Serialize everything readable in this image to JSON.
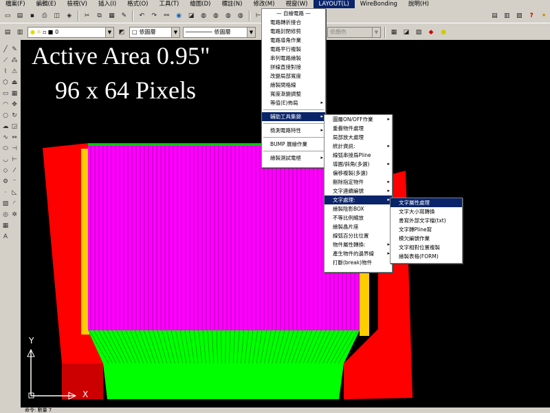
{
  "menubar": {
    "items": [
      "檔案(F)",
      "編輯(E)",
      "檢視(V)",
      "插入(I)",
      "格式(O)",
      "工具(T)",
      "繪圖(D)",
      "標註(N)",
      "修改(M)",
      "視窗(W)",
      "LAYOUT(L)",
      "WireBonding",
      "說明(H)"
    ],
    "active_index": 10
  },
  "toolbar2": {
    "layer_value": "0",
    "linetype_value": "依圖層",
    "lineweight_value": "依圖層",
    "color_value": "依顏色"
  },
  "drawing": {
    "title_line1": "Active Area 0.95\"",
    "title_line2": "96 x 64 Pixels",
    "axis_y": "Y",
    "axis_x": "X",
    "colors": {
      "panel": "#ff00ff",
      "fanout_bottom": "#00ff00",
      "traces": "#ff0000",
      "pads": "#ffcc00",
      "background": "#000000"
    }
  },
  "layout_menu": {
    "header": "— 自繪電路 —",
    "items": [
      {
        "label": "電路轉折接合",
        "sub": false
      },
      {
        "label": "電路封閉修剪",
        "sub": false
      },
      {
        "label": "電路導角作業",
        "sub": false
      },
      {
        "label": "電路平行複製",
        "sub": false
      },
      {
        "label": "串列電路繪製",
        "sub": false
      },
      {
        "label": "拼線直接對接",
        "sub": false
      },
      {
        "label": "改變局部寬度",
        "sub": false
      },
      {
        "label": "繪製間格線",
        "sub": false
      },
      {
        "label": "寬度漸變調整",
        "sub": false
      },
      {
        "label": "等值(E)佈局",
        "sub": true
      }
    ],
    "group2": [
      {
        "label": "輔助工具集錦",
        "sub": true,
        "highlighted": true
      },
      {
        "label": "檢測電路特性",
        "sub": true
      },
      {
        "label": "BUMP 展繪作業",
        "sub": false
      },
      {
        "label": "繪製測試電極",
        "sub": true
      }
    ]
  },
  "aux_menu": {
    "items": [
      {
        "label": "圖層ON/OFF作業",
        "sub": true
      },
      {
        "label": "重疊物件處理",
        "sub": false
      },
      {
        "label": "局部放大處理",
        "sub": false
      },
      {
        "label": "統計資訊:",
        "sub": true
      },
      {
        "label": "線弧串接爲Pline",
        "sub": false
      },
      {
        "label": "導圓/斜角(多選)",
        "sub": true
      },
      {
        "label": "偏移複製(多選)",
        "sub": false
      },
      {
        "label": "刪除指定物件",
        "sub": true
      },
      {
        "label": "文字連續編號",
        "sub": true
      },
      {
        "label": "文字處理:",
        "sub": true,
        "highlighted": true
      },
      {
        "label": "繪製陰影BOX",
        "sub": false
      },
      {
        "label": "不等比例縮放",
        "sub": false
      },
      {
        "label": "繪製晶片座",
        "sub": false
      },
      {
        "label": "線弧百分比位置",
        "sub": false
      },
      {
        "label": "物件屬性轉換:",
        "sub": true
      },
      {
        "label": "產生物件的邊界線",
        "sub": true
      },
      {
        "label": "打斷(break)物件",
        "sub": false
      }
    ]
  },
  "text_menu": {
    "items": [
      {
        "label": "文字屬性處理",
        "highlighted": true
      },
      {
        "label": "文字大小寫轉換"
      },
      {
        "label": "書寫外部文字檔(txt)"
      },
      {
        "label": "文字轉Pline寫"
      },
      {
        "label": "模欠編號作業"
      },
      {
        "label": "文字相對位置複製"
      },
      {
        "label": "繪製表格(FORM)"
      }
    ]
  },
  "statusbar": {
    "text": "命令: 數量 7"
  }
}
